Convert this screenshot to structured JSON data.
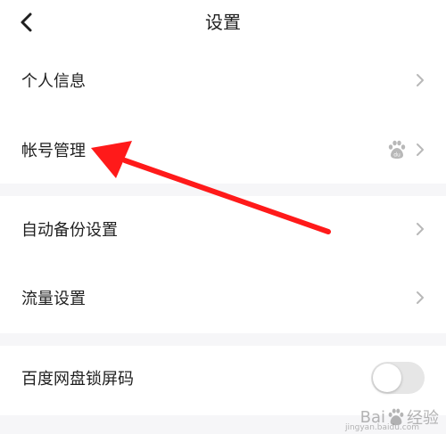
{
  "header": {
    "title": "设置"
  },
  "settings": {
    "items": [
      {
        "label": "个人信息"
      },
      {
        "label": "帐号管理"
      },
      {
        "label": "自动备份设置"
      },
      {
        "label": "流量设置"
      },
      {
        "label": "百度网盘锁屏码"
      }
    ]
  },
  "lock_toggle": {
    "state": "off"
  },
  "watermark": {
    "text": "Bai",
    "text2": "经验",
    "sub": "jingyan.baidu.com"
  },
  "colors": {
    "accent_arrow": "#ff1a1a",
    "separator": "#f6f6f8",
    "text": "#1f1f1f",
    "chevron": "#b8b8b8"
  },
  "icons": {
    "back": "chevron-left-icon",
    "row_arrow": "chevron-right-icon",
    "baidu": "baidu-paw-icon"
  }
}
